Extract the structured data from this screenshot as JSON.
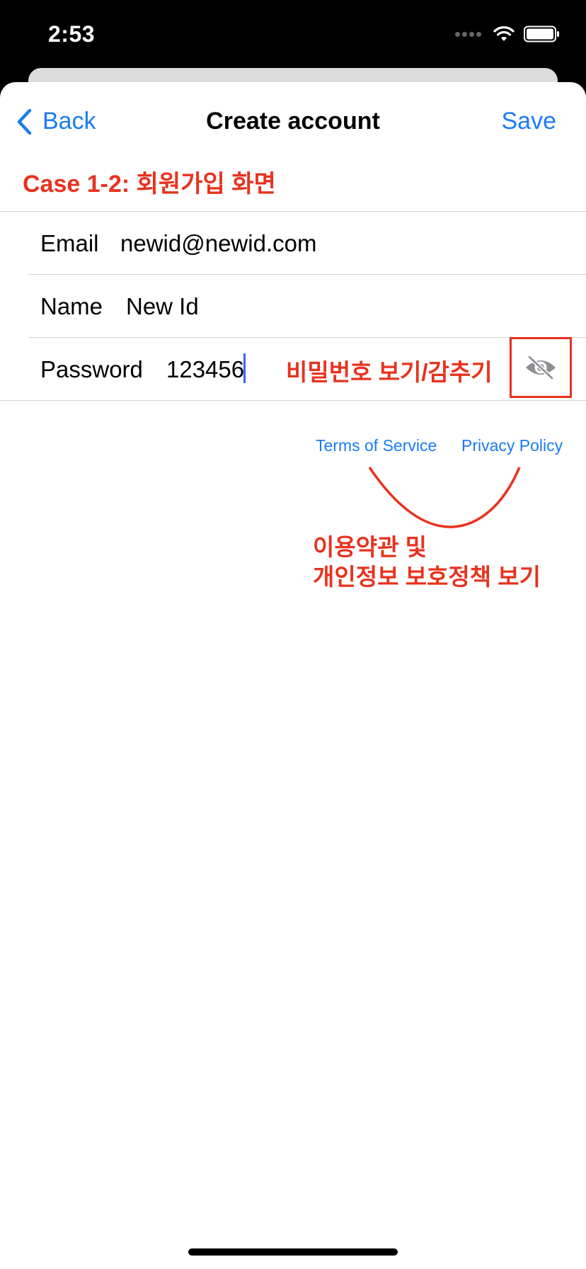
{
  "status_bar": {
    "time": "2:53"
  },
  "nav": {
    "back_label": "Back",
    "title": "Create account",
    "save_label": "Save"
  },
  "annotations": {
    "case_label": "Case 1-2: 회원가입 화면",
    "password_toggle_note": "비밀번호 보기/감추기",
    "links_note_line1": "이용약관 및",
    "links_note_line2": "개인정보 보호정책 보기"
  },
  "form": {
    "email": {
      "label": "Email",
      "value": "newid@newid.com"
    },
    "name": {
      "label": "Name",
      "value": "New Id"
    },
    "password": {
      "label": "Password",
      "value": "123456"
    }
  },
  "links": {
    "terms": "Terms of Service",
    "privacy": "Privacy Policy"
  },
  "colors": {
    "accent": "#1a7cf3",
    "annotation": "#e8321e"
  }
}
